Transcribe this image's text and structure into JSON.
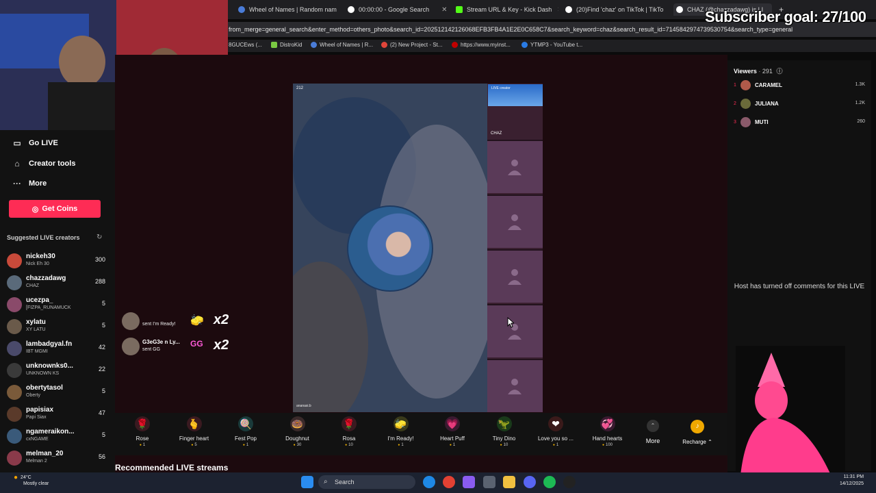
{
  "browser": {
    "tabs": [
      {
        "label": "Wheel of Names | Random nam",
        "color": "#4a7cd8"
      },
      {
        "label": "00:00:00 - Google Search",
        "color": "#ffffff"
      },
      {
        "label": "Stream URL & Key - Kick Dash",
        "color": "#53fc18"
      },
      {
        "label": "(20)Find 'chaz' on TikTok | TikTo",
        "color": "#ffffff"
      },
      {
        "label": "CHAZ (@chazzadawg) is LI",
        "color": "#ffffff"
      }
    ],
    "new_tab": "+",
    "address": "from_merge=general_search&enter_method=others_photo&search_id=202512142126068EFB3FB4A1E2E0C658C7&search_keyword=chaz&search_result_id=7145842974739530754&search_type=general",
    "bookmarks": [
      {
        "label": "8GUCEws (...",
        "color": "#888888"
      },
      {
        "label": "DistroKid",
        "color": "#7ac943"
      },
      {
        "label": "Wheel of Names | R...",
        "color": "#4a7cd8"
      },
      {
        "label": "(2) New Project - St...",
        "color": "#e0453a"
      },
      {
        "label": "https://www.myinst...",
        "color": "#c00000"
      },
      {
        "label": "YTMP3 - YouTube t...",
        "color": "#2a7be4"
      }
    ]
  },
  "overlay": {
    "subscriber_goal": "Subscriber goal: 27/100"
  },
  "sidebar": {
    "nav": [
      {
        "label": "Go LIVE",
        "icon": "camera-icon"
      },
      {
        "label": "Creator tools",
        "icon": "home-icon"
      },
      {
        "label": "More",
        "icon": "more-icon"
      }
    ],
    "get_coins": "Get Coins",
    "suggested_title": "Suggested LIVE creators",
    "creators": [
      {
        "name": "nickeh30",
        "sub": "Nick Eh 30",
        "viewers": "300",
        "color": "#c84a3a"
      },
      {
        "name": "chazzadawg",
        "sub": "CHAZ",
        "viewers": "288",
        "color": "#5a6a7a"
      },
      {
        "name": "ucezpa_",
        "sub": "[FIZPA_RUNAMUCK",
        "viewers": "5",
        "color": "#8a4a6a"
      },
      {
        "name": "xylatu",
        "sub": "XY LATU",
        "viewers": "5",
        "color": "#6a5a4a"
      },
      {
        "name": "lambadgyal.fn",
        "sub": "IBT MGMI",
        "viewers": "42",
        "color": "#4a4a6a"
      },
      {
        "name": "unknownks0...",
        "sub": "UNKNOWN KS",
        "viewers": "22",
        "color": "#3a3a3a"
      },
      {
        "name": "obertytasol",
        "sub": "Oberty",
        "viewers": "5",
        "color": "#7a5a3a"
      },
      {
        "name": "papisiax",
        "sub": "Papi Siax",
        "viewers": "47",
        "color": "#5a3a2a"
      },
      {
        "name": "ngameraikon...",
        "sub": "cxNGAME",
        "viewers": "5",
        "color": "#3a5a7a"
      },
      {
        "name": "melman_20",
        "sub": "Melman 2",
        "viewers": "56",
        "color": "#8a3a4a"
      }
    ]
  },
  "stage": {
    "viewer_count": "212",
    "host_tag": "ananasi.b",
    "guest_label": "LIVE creator",
    "guest_name": "CHAZ"
  },
  "gift_feed": [
    {
      "name": "",
      "action": "sent I'm Ready!",
      "gift": "🧽",
      "multiplier": "x2"
    },
    {
      "name": "G3eG3e n Ly...",
      "action": "sent GG",
      "gift": "GG",
      "multiplier": "x2"
    }
  ],
  "gifts": [
    {
      "label": "Rose",
      "price": "1",
      "icon": "🌹",
      "bg": "#3a1a20"
    },
    {
      "label": "Finger heart",
      "price": "5",
      "icon": "🫰",
      "bg": "#3a1a20"
    },
    {
      "label": "Fest Pop",
      "price": "1",
      "icon": "🍭",
      "bg": "#1a3a3a"
    },
    {
      "label": "Doughnut",
      "price": "30",
      "icon": "🍩",
      "bg": "#3a2a2a"
    },
    {
      "label": "Rosa",
      "price": "10",
      "icon": "🌹",
      "bg": "#3a1a20"
    },
    {
      "label": "I'm Ready!",
      "price": "1",
      "icon": "🧽",
      "bg": "#3a3a1a"
    },
    {
      "label": "Heart Puff",
      "price": "1",
      "icon": "💗",
      "bg": "#3a1a30"
    },
    {
      "label": "Tiny Dino",
      "price": "10",
      "icon": "🦖",
      "bg": "#1a3a1a"
    },
    {
      "label": "Love you so ...",
      "price": "1",
      "icon": "❤",
      "bg": "#3a1a1a"
    },
    {
      "label": "Hand hearts",
      "price": "100",
      "icon": "💞",
      "bg": "#3a1a30"
    }
  ],
  "more_label": "More",
  "recharge_label": "Recharge",
  "recommended": "Recommended LIVE streams",
  "viewers_panel": {
    "title": "Viewers",
    "count": "291",
    "list": [
      {
        "rank": "1",
        "name": "CARAMEL",
        "score": "1.3K",
        "color": "#b05a4a"
      },
      {
        "rank": "2",
        "name": "JULIANA",
        "score": "1.2K",
        "color": "#6a6a3a"
      },
      {
        "rank": "3",
        "name": "MUTI",
        "score": "260",
        "color": "#8a5a6a"
      }
    ],
    "comments_off": "Host has turned off comments for this LIVE"
  },
  "taskbar": {
    "temp": "24°C",
    "weather": "Mostly clear",
    "search": "Search",
    "time": "11:31 PM",
    "date": "14/12/2025"
  }
}
